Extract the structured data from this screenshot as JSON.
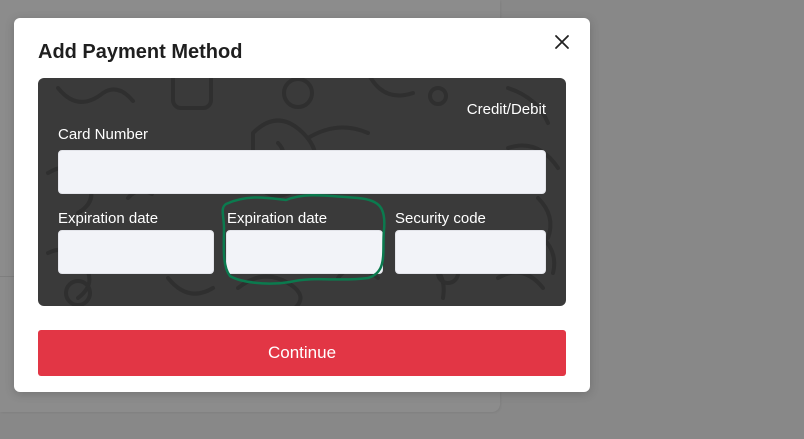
{
  "modal": {
    "title": "Add Payment Method",
    "close_icon": "close-icon"
  },
  "card": {
    "type_label": "Credit/Debit",
    "card_number": {
      "label": "Card Number",
      "value": "",
      "placeholder": ""
    },
    "expiration_date": {
      "label": "Expiration date",
      "value": "",
      "placeholder": ""
    },
    "expiration_date_2": {
      "label": "Expiration date",
      "value": "",
      "placeholder": ""
    },
    "security_code": {
      "label": "Security code",
      "value": "",
      "placeholder": ""
    }
  },
  "actions": {
    "continue_label": "Continue"
  },
  "colors": {
    "overlay": "#888888",
    "card_background": "#3a3a3a",
    "input_background": "#f2f3f8",
    "primary_button": "#e23645",
    "annotation": "#0b7a4e"
  }
}
